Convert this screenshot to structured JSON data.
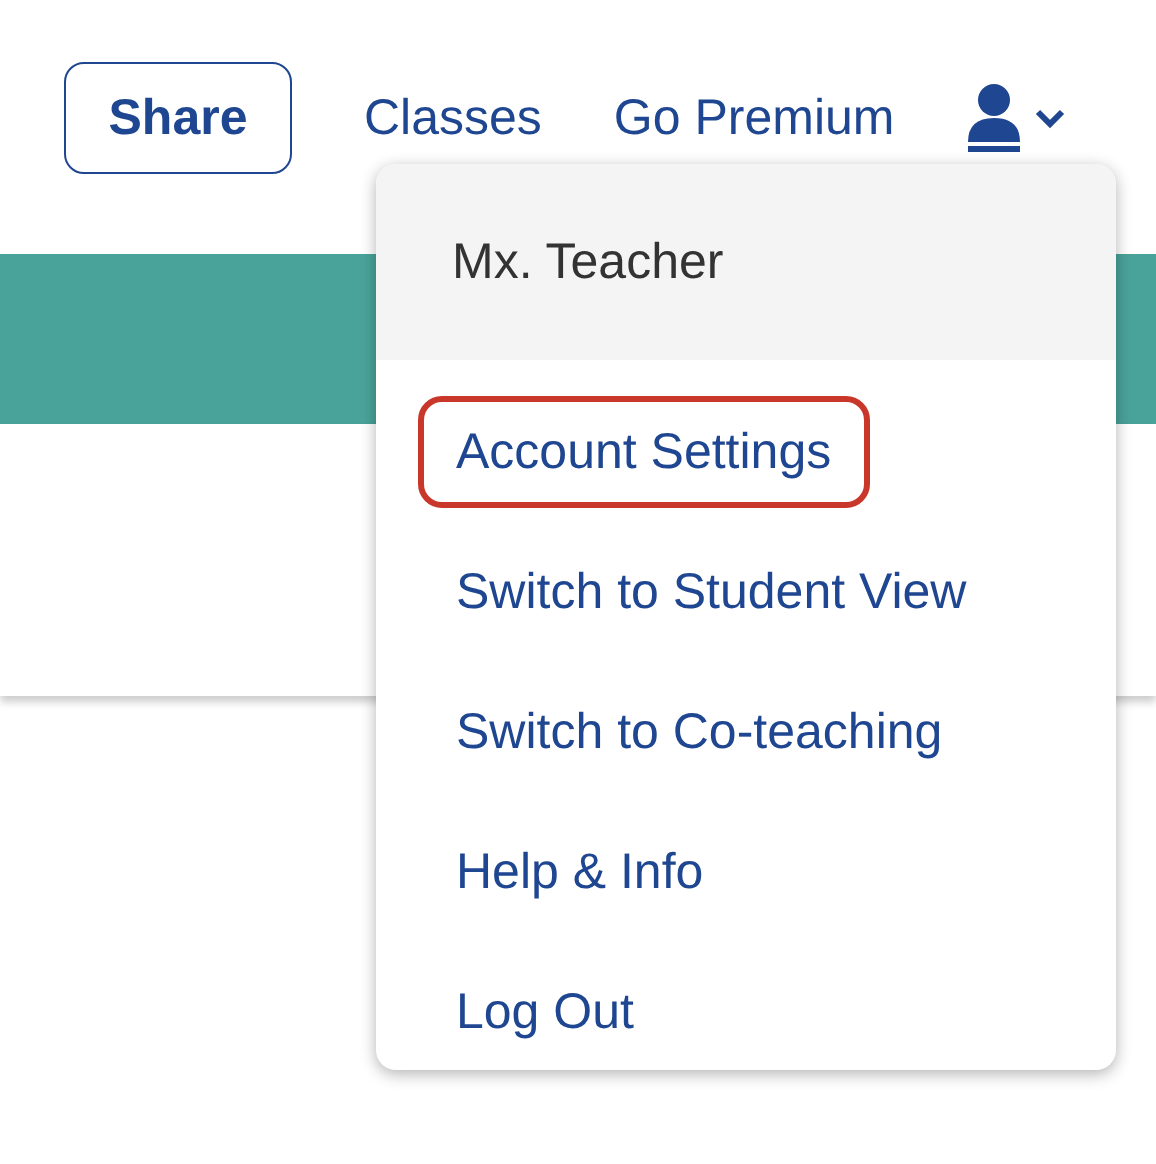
{
  "nav": {
    "share_button": "Share",
    "links": [
      "Classes",
      "Go Premium"
    ]
  },
  "user_menu": {
    "header": "Mx. Teacher",
    "items": [
      {
        "label": "Account Settings",
        "highlighted": true
      },
      {
        "label": "Switch to Student View",
        "highlighted": false
      },
      {
        "label": "Switch to Co-teaching",
        "highlighted": false
      },
      {
        "label": "Help & Info",
        "highlighted": false
      },
      {
        "label": "Log Out",
        "highlighted": false
      }
    ]
  }
}
